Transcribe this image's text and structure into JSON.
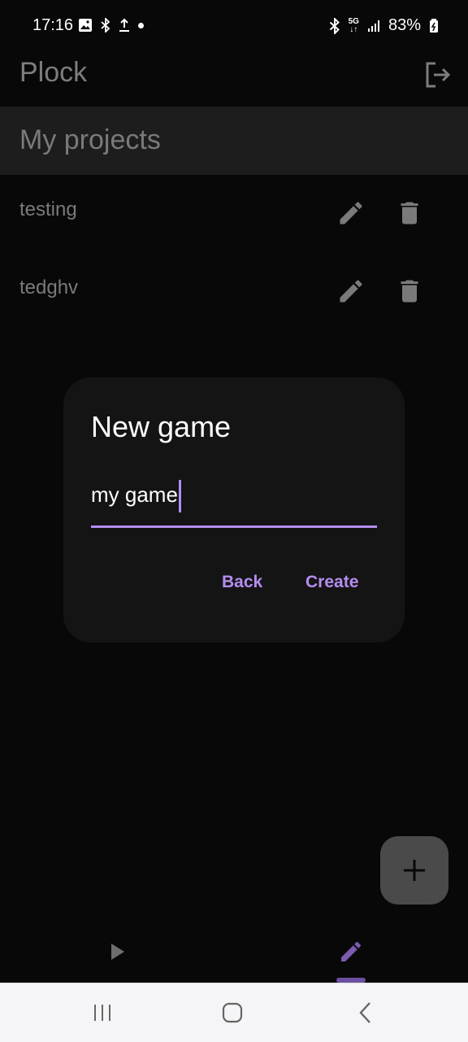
{
  "status_bar": {
    "time": "17:16",
    "battery": "83%",
    "network": "5G",
    "left_icons": [
      "image-icon",
      "bluetooth-icon",
      "upload-icon",
      "dot-icon"
    ],
    "right_icons": [
      "bluetooth-icon",
      "5g-icon",
      "signal-icon",
      "battery-icon"
    ]
  },
  "appbar": {
    "title": "Plock",
    "logout_icon": "logout-icon"
  },
  "section": {
    "title": "My projects"
  },
  "projects": [
    {
      "name": "testing"
    },
    {
      "name": "tedghv"
    }
  ],
  "dialog": {
    "title": "New game",
    "input_value": "my game",
    "back_label": "Back",
    "create_label": "Create"
  },
  "fab": {
    "icon": "plus-icon"
  },
  "bottom_nav": {
    "items": [
      "play-icon",
      "pencil-icon"
    ],
    "selected": "pencil-icon"
  },
  "system_nav": [
    "recents-icon",
    "home-icon",
    "back-icon"
  ],
  "colors": {
    "accent": "#b58cf0",
    "background": "#080808",
    "dialog": "#141414"
  }
}
